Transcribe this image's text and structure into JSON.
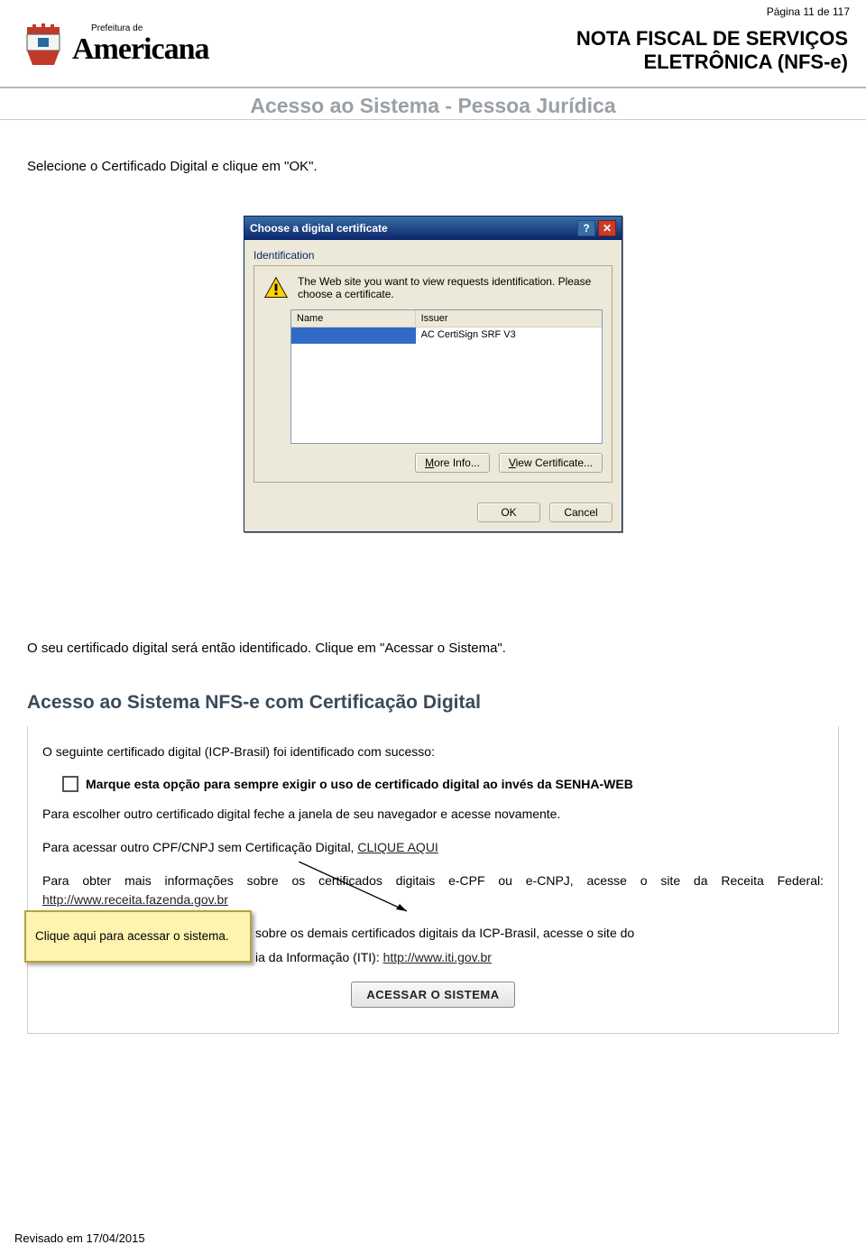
{
  "header": {
    "page_no": "Página 11 de 117",
    "prefeitura": "Prefeitura de",
    "city": "Americana",
    "doc_title_line1": "NOTA FISCAL DE SERVIÇOS",
    "doc_title_line2": "ELETRÔNICA (NFS-e)",
    "subtitle": "Acesso ao Sistema - Pessoa Jurídica"
  },
  "instr1": "Selecione o Certificado Digital e clique em \"OK\".",
  "dialog": {
    "title": "Choose a digital certificate",
    "group": "Identification",
    "msg": "The Web site you want to view requests identification. Please choose a certificate.",
    "col_name": "Name",
    "col_issuer": "Issuer",
    "issuer_val": "AC CertiSign SRF V3",
    "more": "More Info...",
    "view": "View Certificate...",
    "ok": "OK",
    "cancel": "Cancel"
  },
  "instr2": "O seu certificado digital será então identificado. Clique em \"Acessar o Sistema\".",
  "panel": {
    "title": "Acesso ao Sistema NFS-e com Certificação Digital",
    "success": "O seguinte certificado digital (ICP-Brasil) foi identificado com sucesso:",
    "checkbox": "Marque esta opção para sempre exigir o uso de certificado digital ao invés da SENHA-WEB",
    "other_cert": "Para escolher outro certificado digital feche a janela de seu navegador e acesse novamente.",
    "other_cpf_pre": "Para acessar outro CPF/CNPJ sem Certificação Digital, ",
    "other_cpf_link": "CLIQUE AQUI",
    "receita_pre": "Para obter mais informações sobre os certificados digitais e-CPF ou e-CNPJ, acesse o site da Receita Federal: ",
    "receita_link": "http://www.receita.fazenda.gov.br",
    "iti_mid": " sobre os demais certificados digitais da ICP-Brasil, acesse o site do ",
    "iti_end": "ia da Informação (ITI): ",
    "iti_link": "http://www.iti.gov.br",
    "button": "ACESSAR O SISTEMA"
  },
  "callout": "Clique aqui para acessar o sistema.",
  "footer": "Revisado em 17/04/2015"
}
